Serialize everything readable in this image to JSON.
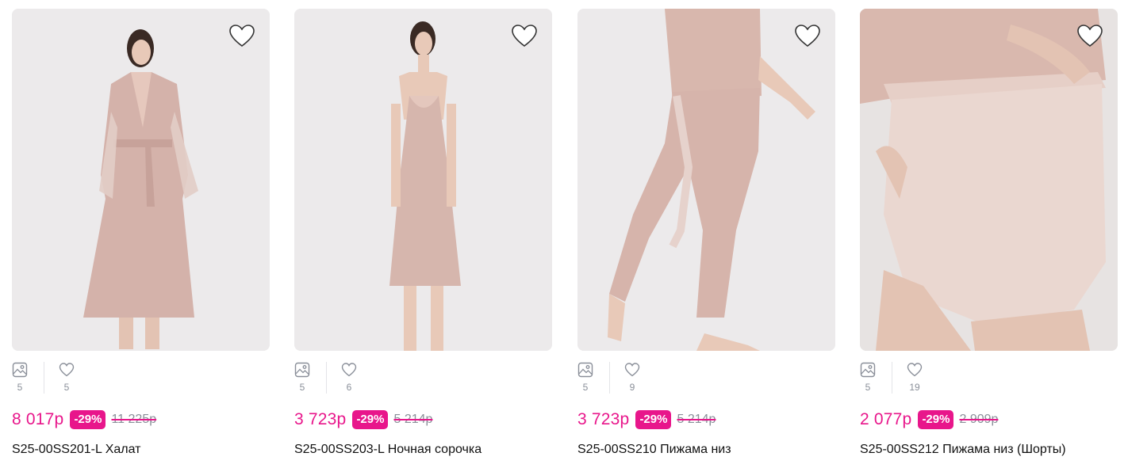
{
  "colors": {
    "accent": "#e8168b",
    "muted": "#8a8f99",
    "photo_bg": "#ebe9ea",
    "garment": "#d9b8b0"
  },
  "products": [
    {
      "price": "8 017р",
      "discount": "-29%",
      "old_price": "11 225р",
      "title": "S25-00SS201-L Халат",
      "photos_count": "5",
      "likes_count": "5"
    },
    {
      "price": "3 723р",
      "discount": "-29%",
      "old_price": "5 214р",
      "title": "S25-00SS203-L Ночная сорочка",
      "photos_count": "5",
      "likes_count": "6"
    },
    {
      "price": "3 723р",
      "discount": "-29%",
      "old_price": "5 214р",
      "title": "S25-00SS210 Пижама низ",
      "photos_count": "5",
      "likes_count": "9"
    },
    {
      "price": "2 077р",
      "discount": "-29%",
      "old_price": "2 909р",
      "title": "S25-00SS212 Пижама низ (Шорты)",
      "photos_count": "5",
      "likes_count": "19"
    }
  ]
}
